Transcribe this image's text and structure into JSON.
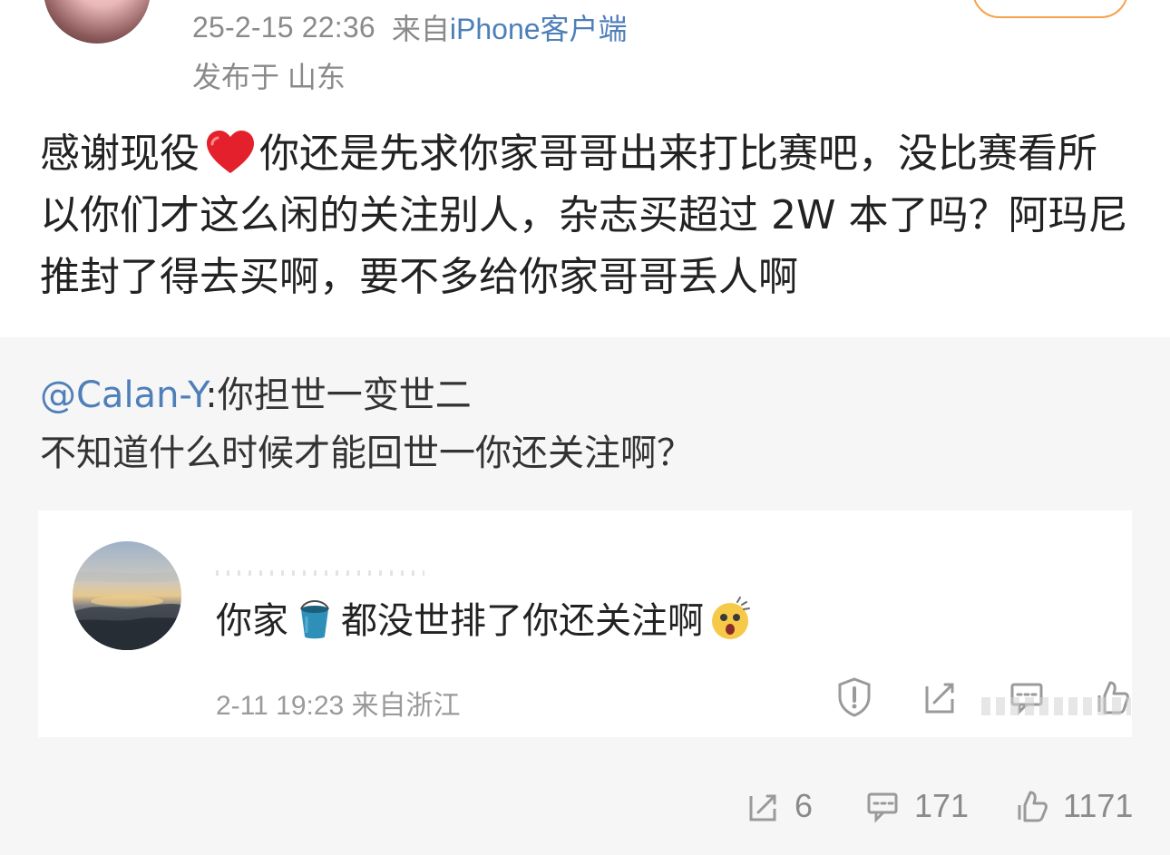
{
  "post": {
    "time": "25-2-15 22:36",
    "from_prefix": "来自",
    "client": "iPhone客户端",
    "location": "发布于 山东",
    "body_part1": "感谢现役",
    "body_part2": "你还是先求你家哥哥出来打比赛吧，没比赛看所以你们才这么闲的关注别人，杂志买超过 2W 本了吗？阿玛尼推封了得去买啊，要不多给你家哥哥丢人啊"
  },
  "repost": {
    "mention": "@Calan-Y",
    "text_after_mention": ":你担世一变世二",
    "line2": "不知道什么时候才能回世一你还关注啊？"
  },
  "quoted_comment": {
    "text_part1": "你家",
    "text_part2": "都没世排了你还关注啊",
    "time_location": "2-11 19:23 来自浙江"
  },
  "stats": {
    "reposts": "6",
    "comments": "171",
    "likes": "1171"
  },
  "colors": {
    "link": "#4f7fb8",
    "meta_gray": "#8a8a8a",
    "repost_bg": "#f6f6f6",
    "follow_orange": "#f6a14a"
  },
  "icons": {
    "heart": "heart-emoji",
    "bucket": "bucket-emoji",
    "shocked": "shocked-face-emoji",
    "report": "report-shield-icon",
    "edit": "repost-edit-icon",
    "comment": "comment-icon",
    "like": "like-thumb-icon"
  }
}
